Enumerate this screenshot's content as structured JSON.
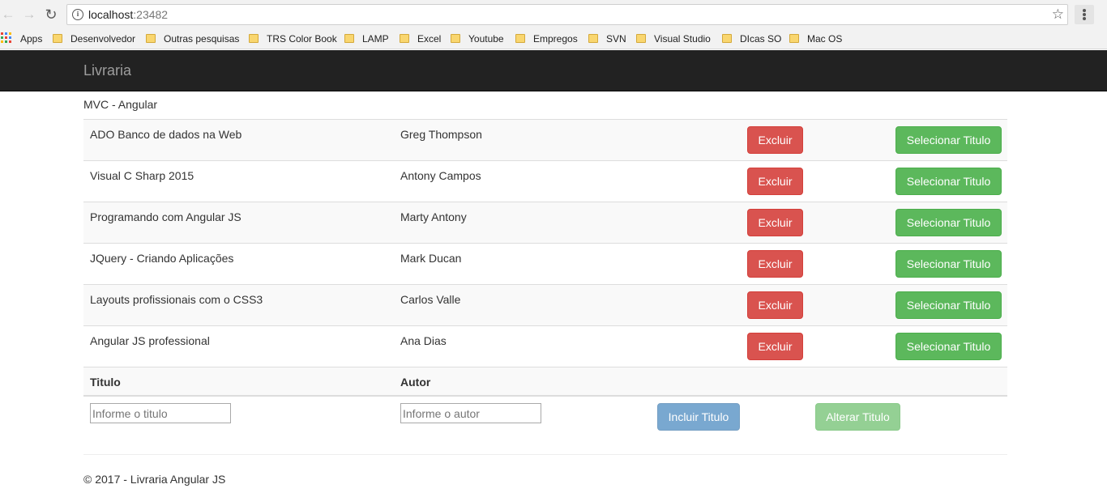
{
  "browser": {
    "url_host": "localhost",
    "url_port": ":23482",
    "bookmarks": [
      {
        "label": "Apps",
        "icon": "apps-grid-icon"
      },
      {
        "label": "Desenvolvedor",
        "icon": "folder-icon"
      },
      {
        "label": "Outras pesquisas",
        "icon": "folder-icon"
      },
      {
        "label": "TRS Color Book",
        "icon": "folder-icon"
      },
      {
        "label": "LAMP",
        "icon": "folder-icon"
      },
      {
        "label": "Excel",
        "icon": "folder-icon"
      },
      {
        "label": "Youtube",
        "icon": "folder-icon"
      },
      {
        "label": "Empregos",
        "icon": "folder-icon"
      },
      {
        "label": "SVN",
        "icon": "folder-icon"
      },
      {
        "label": "Visual Studio",
        "icon": "folder-icon"
      },
      {
        "label": "DIcas SO",
        "icon": "folder-icon"
      },
      {
        "label": "Mac OS",
        "icon": "folder-icon"
      }
    ]
  },
  "navbar": {
    "brand": "Livraria"
  },
  "page": {
    "subtitle": "MVC - Angular"
  },
  "books": [
    {
      "titulo": "ADO Banco de dados na Web",
      "autor": "Greg Thompson"
    },
    {
      "titulo": "Visual C Sharp 2015",
      "autor": "Antony Campos"
    },
    {
      "titulo": "Programando com Angular JS",
      "autor": "Marty Antony"
    },
    {
      "titulo": "JQuery - Criando Aplicações",
      "autor": "Mark Ducan"
    },
    {
      "titulo": "Layouts profissionais com o CSS3",
      "autor": "Carlos Valle"
    },
    {
      "titulo": "Angular JS professional",
      "autor": "Ana Dias"
    }
  ],
  "row_actions": {
    "delete_label": "Excluir",
    "select_label": "Selecionar Titulo"
  },
  "form": {
    "col_titulo": "Titulo",
    "col_autor": "Autor",
    "titulo_placeholder": "Informe o titulo",
    "autor_placeholder": "Informe o autor",
    "titulo_value": "",
    "autor_value": "",
    "add_label": "Incluir Titulo",
    "edit_label": "Alterar Titulo"
  },
  "footer": {
    "text": "© 2017 - Livraria Angular JS"
  },
  "colors": {
    "navbar_bg": "#222222",
    "danger": "#d9534f",
    "success": "#5cb85c",
    "primary": "#337ab7"
  }
}
